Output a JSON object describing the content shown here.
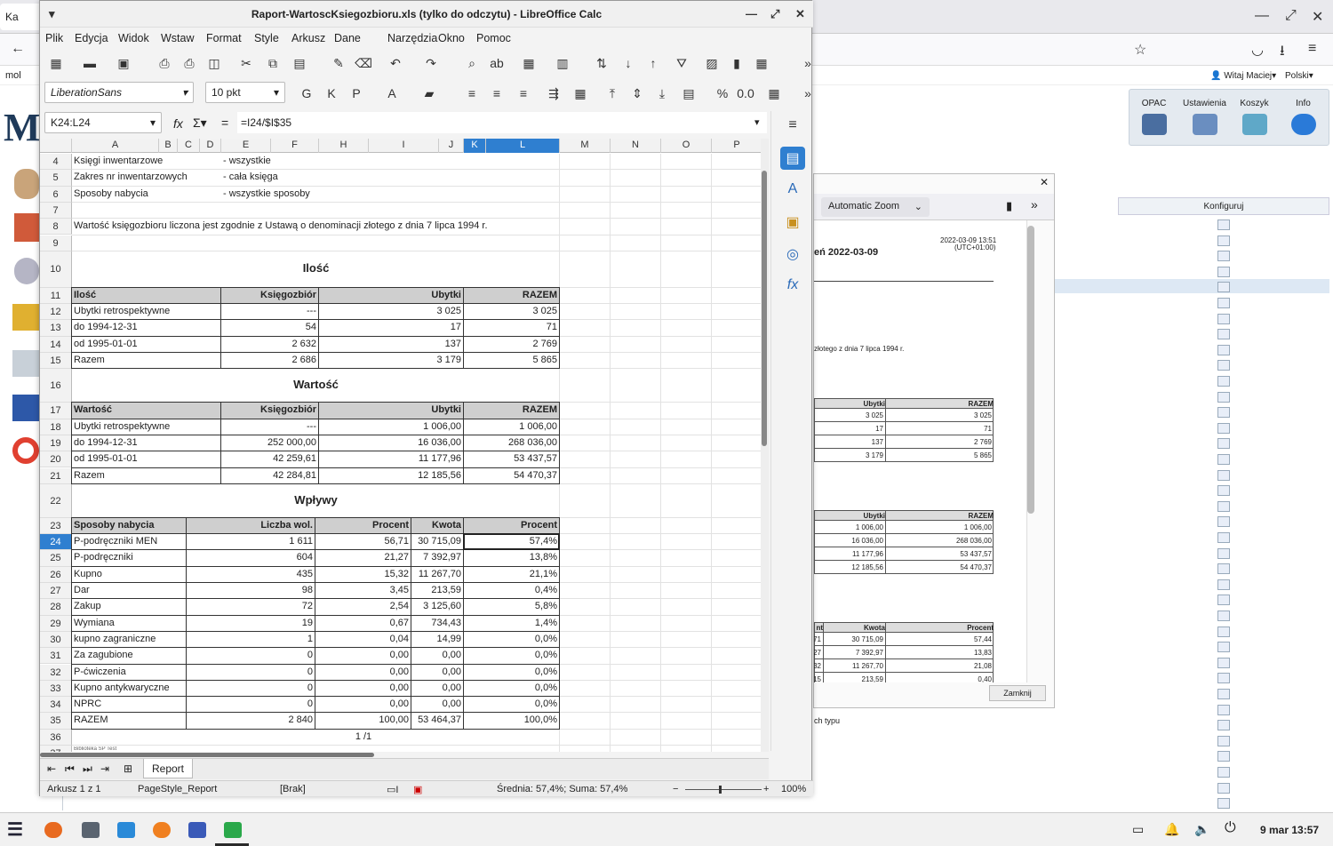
{
  "firefox": {
    "tab_label": "Ka",
    "bookmark_label": "mol",
    "user_label": "Witaj Maciej",
    "lang_label": "Polski",
    "logo_letter": "M",
    "opac": [
      "OPAC",
      "Ustawienia",
      "Koszyk",
      "Info"
    ],
    "konfiguruj": "Konfiguruj",
    "under_text": "ch typu"
  },
  "pdf": {
    "zoom": "Automatic Zoom",
    "stamp": "2022-03-09 13:51",
    "stamp2": "(UTC+01:00)",
    "title": "eń 2022-03-09",
    "line": "złotego z dnia 7 lipca 1994 r.",
    "t1_head": [
      "Ubytki",
      "RAZEM"
    ],
    "t1_rows": [
      [
        "3 025",
        "3 025"
      ],
      [
        "17",
        "71"
      ],
      [
        "137",
        "2 769"
      ],
      [
        "3 179",
        "5 865"
      ]
    ],
    "t2_head": [
      "Ubytki",
      "RAZEM"
    ],
    "t2_rows": [
      [
        "1 006,00",
        "1 006,00"
      ],
      [
        "16 036,00",
        "268 036,00"
      ],
      [
        "11 177,96",
        "53 437,57"
      ],
      [
        "12 185,56",
        "54 470,37"
      ]
    ],
    "t3_head": [
      "nt",
      "Kwota",
      "Procent"
    ],
    "t3_rows": [
      [
        "71",
        "30 715,09",
        "57,44"
      ],
      [
        "27",
        "7 392,97",
        "13,83"
      ],
      [
        "32",
        "11 267,70",
        "21,08"
      ],
      [
        "15",
        "213,59",
        "0,40"
      ]
    ],
    "close": "Zamknij"
  },
  "calc": {
    "title": "Raport-WartoscKsiegozbioru.xls (tylko do odczytu) - LibreOffice Calc",
    "menu": [
      "Plik",
      "Edycja",
      "Widok",
      "Wstaw",
      "Format",
      "Style",
      "Arkusz",
      "Dane",
      "Narzędzia",
      "Okno",
      "Pomoc"
    ],
    "font_name": "LiberationSans",
    "font_size": "10 pkt",
    "name_box": "K24:L24",
    "formula": "=I24/$I$35",
    "columns": [
      "A",
      "B",
      "C",
      "D",
      "E",
      "F",
      "H",
      "I",
      "J",
      "K",
      "L",
      "M",
      "N",
      "O",
      "P"
    ],
    "rows": [
      "4",
      "5",
      "6",
      "7",
      "8",
      "9",
      "10",
      "11",
      "12",
      "13",
      "14",
      "15",
      "16",
      "17",
      "18",
      "19",
      "20",
      "21",
      "22",
      "23",
      "24",
      "25",
      "26",
      "27",
      "28",
      "29",
      "30",
      "31",
      "32",
      "33",
      "34",
      "35",
      "36",
      "37"
    ],
    "info": [
      [
        "Księgi inwentarzowe",
        "- wszystkie"
      ],
      [
        "Zakres nr inwentarzowych",
        "- cała księga"
      ],
      [
        "Sposoby nabycia",
        "- wszystkie sposoby"
      ]
    ],
    "note": "Wartość księgozbioru liczona jest zgodnie z Ustawą o denominacji złotego z dnia 7 lipca 1994 r.",
    "ilosc_title": "Ilość",
    "ilosc_head": [
      "Ilość",
      "Księgozbiór",
      "Ubytki",
      "RAZEM"
    ],
    "ilosc_rows": [
      [
        "Ubytki retrospektywne",
        "---",
        "3 025",
        "3 025"
      ],
      [
        "do 1994-12-31",
        "54",
        "17",
        "71"
      ],
      [
        "od 1995-01-01",
        "2 632",
        "137",
        "2 769"
      ],
      [
        "Razem",
        "2 686",
        "3 179",
        "5 865"
      ]
    ],
    "wartosc_title": "Wartość",
    "wartosc_head": [
      "Wartość",
      "Księgozbiór",
      "Ubytki",
      "RAZEM"
    ],
    "wartosc_rows": [
      [
        "Ubytki retrospektywne",
        "---",
        "1 006,00",
        "1 006,00"
      ],
      [
        "do 1994-12-31",
        "252 000,00",
        "16 036,00",
        "268 036,00"
      ],
      [
        "od 1995-01-01",
        "42 259,61",
        "11 177,96",
        "53 437,57"
      ],
      [
        "Razem",
        "42 284,81",
        "12 185,56",
        "54 470,37"
      ]
    ],
    "wplywy_title": "Wpływy",
    "wplywy_head": [
      "Sposoby nabycia",
      "Liczba wol.",
      "Procent",
      "Kwota",
      "Procent"
    ],
    "wplywy_rows": [
      [
        "P-podręczniki MEN",
        "1 611",
        "56,71",
        "30 715,09",
        "57,4%"
      ],
      [
        "P-podręczniki",
        "604",
        "21,27",
        "7 392,97",
        "13,8%"
      ],
      [
        "Kupno",
        "435",
        "15,32",
        "11 267,70",
        "21,1%"
      ],
      [
        "Dar",
        "98",
        "3,45",
        "213,59",
        "0,4%"
      ],
      [
        "Zakup",
        "72",
        "2,54",
        "3 125,60",
        "5,8%"
      ],
      [
        "Wymiana",
        "19",
        "0,67",
        "734,43",
        "1,4%"
      ],
      [
        "kupno zagraniczne",
        "1",
        "0,04",
        "14,99",
        "0,0%"
      ],
      [
        "Za zagubione",
        "0",
        "0,00",
        "0,00",
        "0,0%"
      ],
      [
        "P-ćwiczenia",
        "0",
        "0,00",
        "0,00",
        "0,0%"
      ],
      [
        "Kupno antykwaryczne",
        "0",
        "0,00",
        "0,00",
        "0,0%"
      ],
      [
        "NPRC",
        "0",
        "0,00",
        "0,00",
        "0,0%"
      ],
      [
        "RAZEM",
        "2 840",
        "100,00",
        "53 464,37",
        "100,0%"
      ]
    ],
    "page_label": "1 /1",
    "footer_tiny": "Biblioteka SP Test",
    "sheet_tab": "Report",
    "status": {
      "sheet": "Arkusz 1 z 1",
      "style": "PageStyle_Report",
      "lang": "[Brak]",
      "sum": "Średnia: 57,4%; Suma: 57,4%",
      "zoom": "100%"
    }
  },
  "taskbar": {
    "clock": "9 mar 13:57"
  }
}
